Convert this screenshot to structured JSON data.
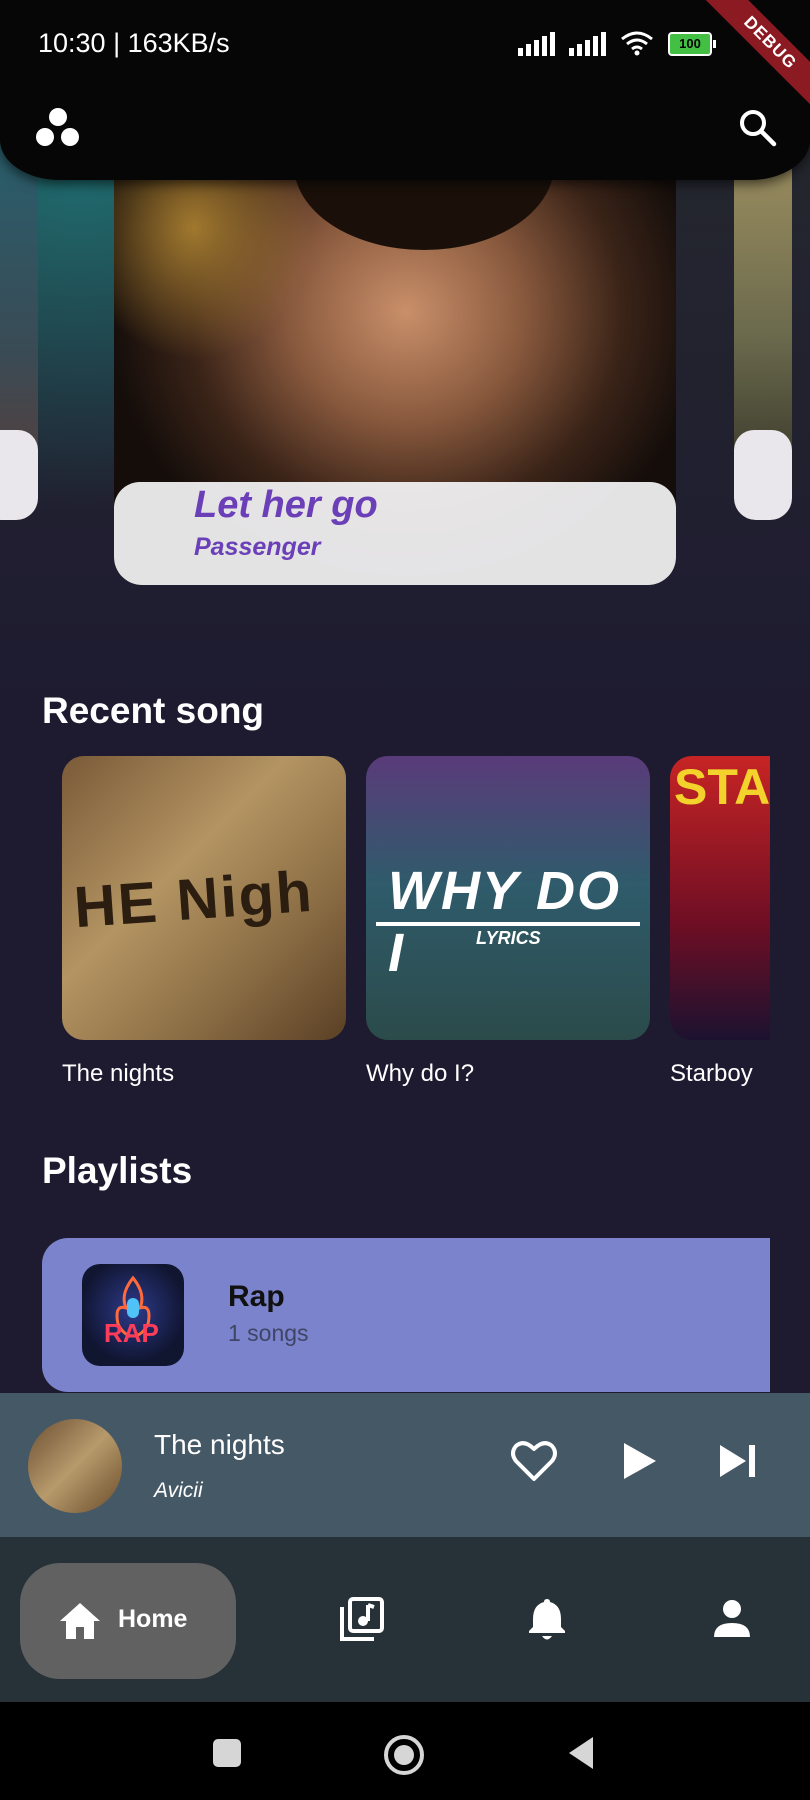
{
  "status_bar": {
    "time": "10:30 | 163KB/s",
    "battery": "100",
    "debug_banner": "DEBUG"
  },
  "featured": {
    "title": "Let her go",
    "artist": "Passenger"
  },
  "recent": {
    "title": "Recent song",
    "items": [
      {
        "label": "The nights",
        "art_text": "HE Nigh"
      },
      {
        "label": "Why do I?",
        "art_text": "WHY DO I",
        "art_sub": "LYRICS"
      },
      {
        "label": "Starboy",
        "art_text": "STA"
      }
    ]
  },
  "playlists": {
    "title": "Playlists",
    "items": [
      {
        "name": "Rap",
        "count": "1 songs",
        "art_text": "RAP"
      }
    ]
  },
  "now_playing": {
    "title": "The nights",
    "artist": "Avicii"
  },
  "bottom_nav": {
    "home_label": "Home"
  },
  "colors": {
    "accent": "#6a3fb8",
    "playlist_card": "#7a83cb",
    "mini_player": "#455865",
    "nav_bg": "#263238"
  }
}
